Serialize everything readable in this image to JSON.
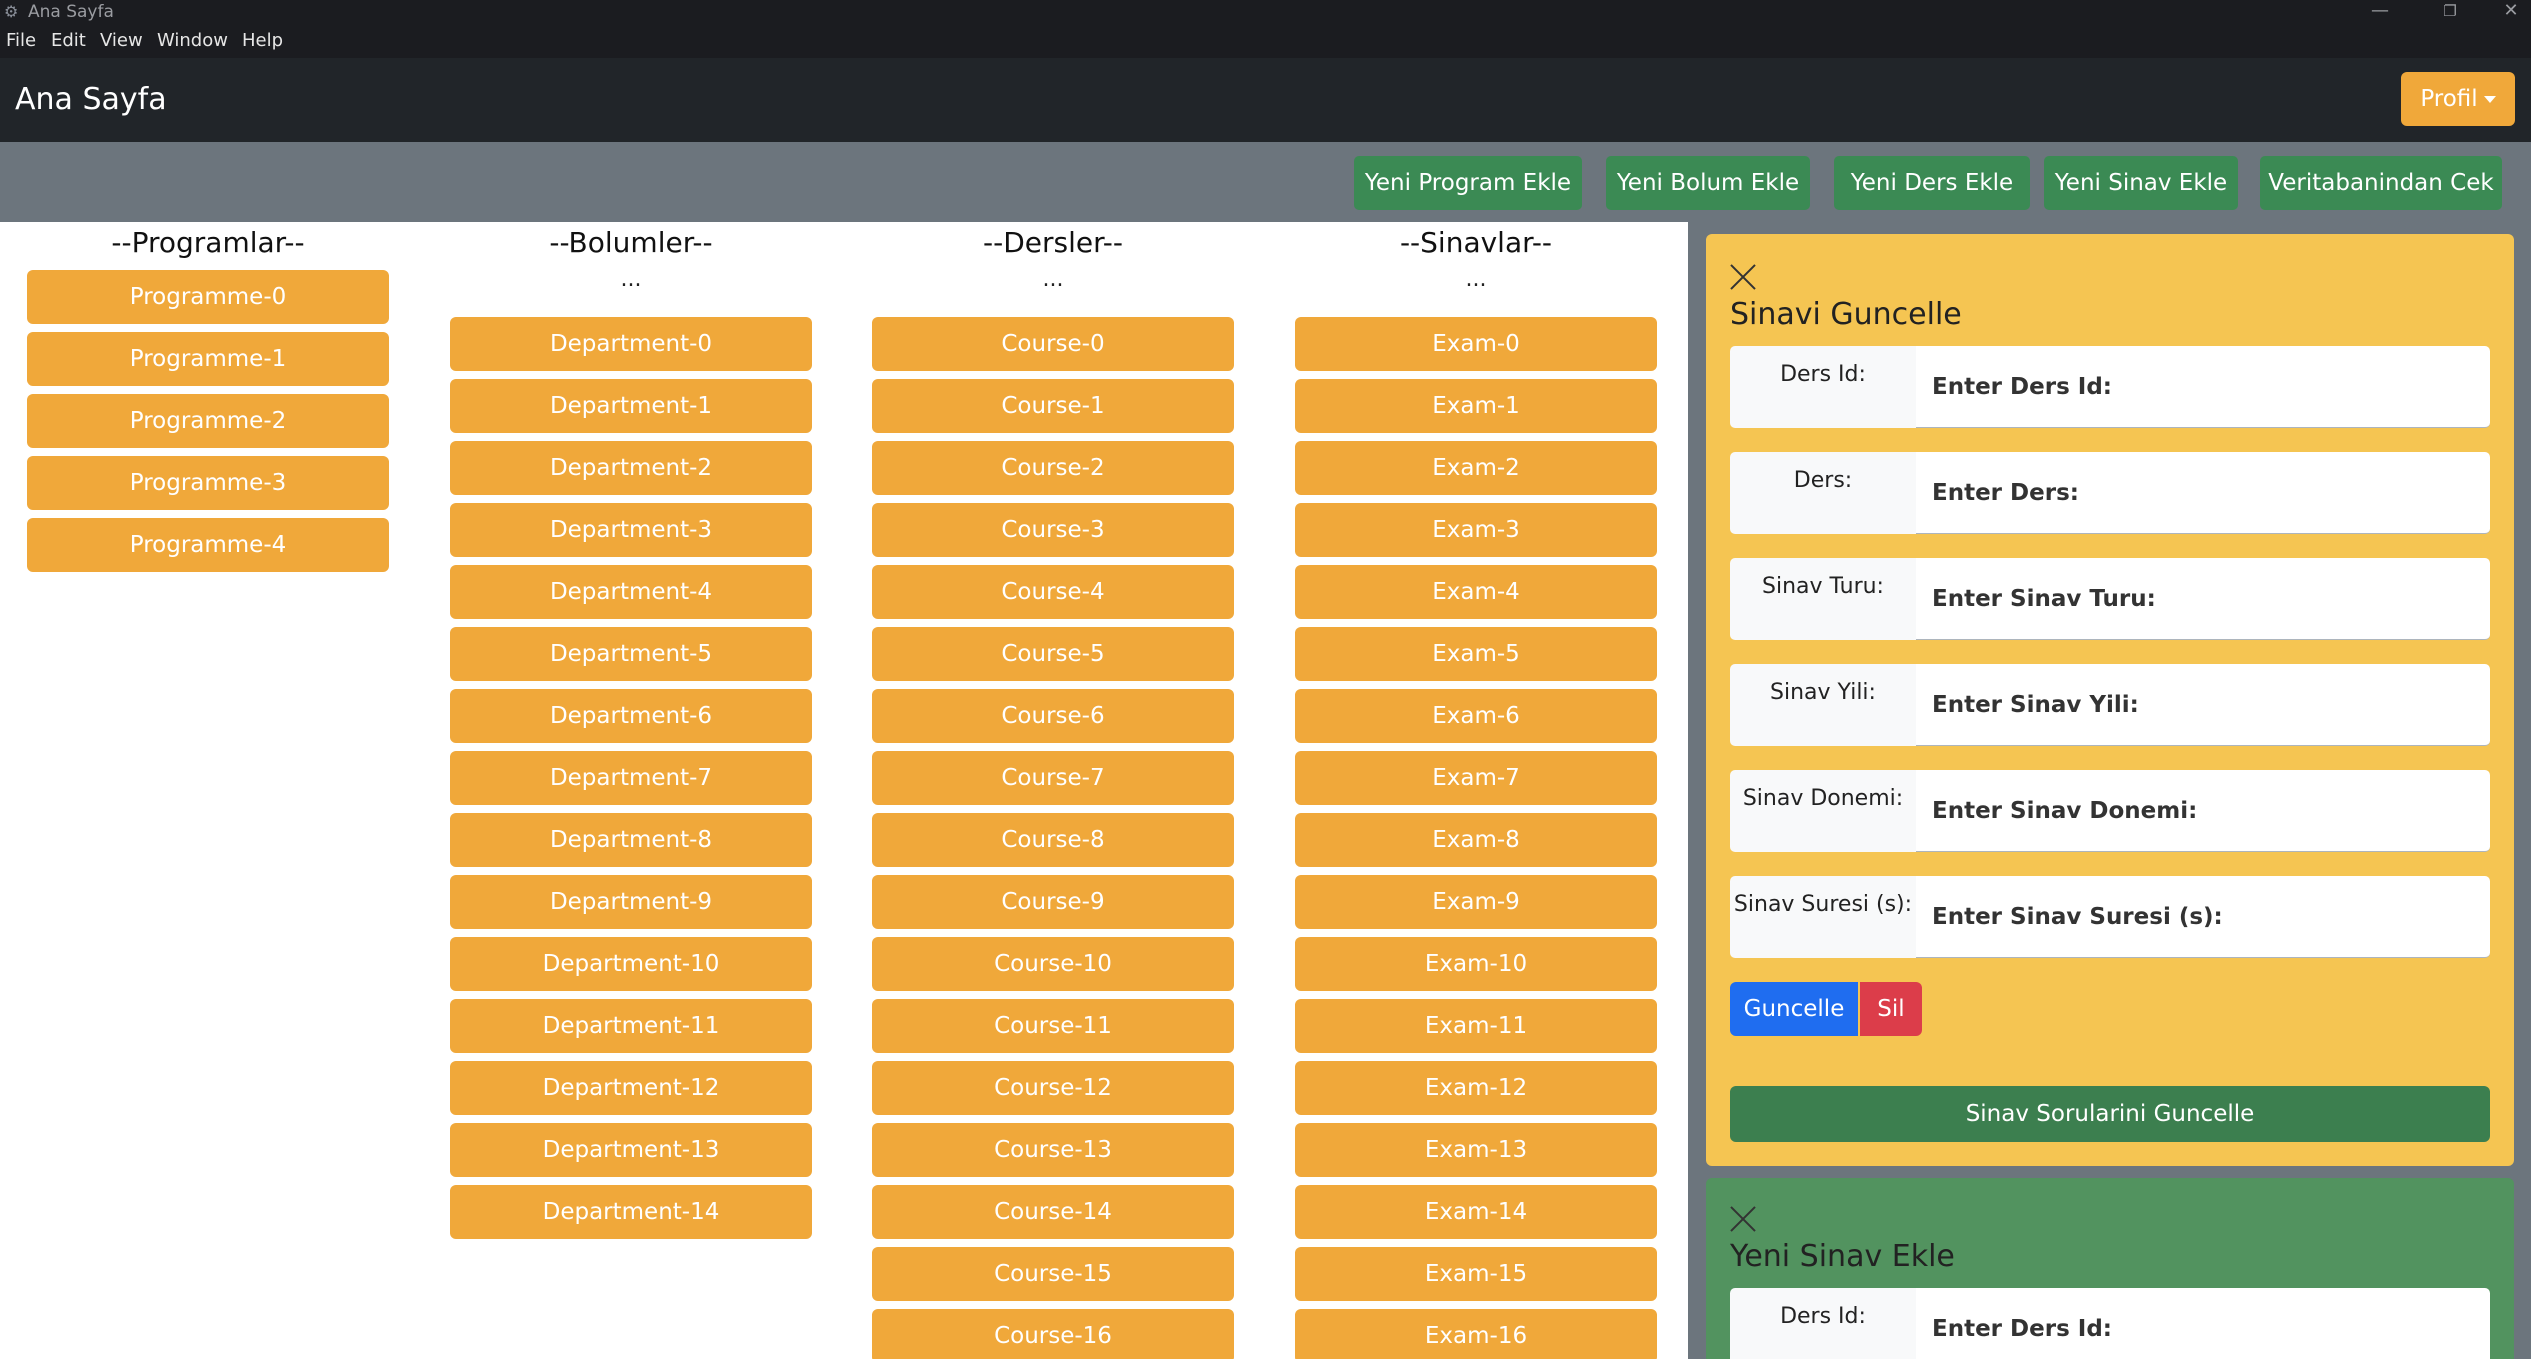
{
  "window": {
    "title": "Ana Sayfa",
    "minimize": "—",
    "restore": "❐",
    "close": "✕"
  },
  "menu": [
    "File",
    "Edit",
    "View",
    "Window",
    "Help"
  ],
  "navbar": {
    "brand": "Ana Sayfa",
    "profil_label": "Profil"
  },
  "actions": [
    "Yeni Program Ekle",
    "Yeni Bolum Ekle",
    "Yeni Ders Ekle",
    "Yeni Sinav Ekle",
    "Veritabanindan Cek"
  ],
  "columns": {
    "programlar": {
      "title": "--Programlar--",
      "dots": "",
      "items": [
        "Programme-0",
        "Programme-1",
        "Programme-2",
        "Programme-3",
        "Programme-4"
      ]
    },
    "bolumler": {
      "title": "--Bolumler--",
      "dots": "...",
      "items": [
        "Department-0",
        "Department-1",
        "Department-2",
        "Department-3",
        "Department-4",
        "Department-5",
        "Department-6",
        "Department-7",
        "Department-8",
        "Department-9",
        "Department-10",
        "Department-11",
        "Department-12",
        "Department-13",
        "Department-14"
      ]
    },
    "dersler": {
      "title": "--Dersler--",
      "dots": "...",
      "items": [
        "Course-0",
        "Course-1",
        "Course-2",
        "Course-3",
        "Course-4",
        "Course-5",
        "Course-6",
        "Course-7",
        "Course-8",
        "Course-9",
        "Course-10",
        "Course-11",
        "Course-12",
        "Course-13",
        "Course-14",
        "Course-15",
        "Course-16"
      ]
    },
    "sinavlar": {
      "title": "--Sinavlar--",
      "dots": "...",
      "items": [
        "Exam-0",
        "Exam-1",
        "Exam-2",
        "Exam-3",
        "Exam-4",
        "Exam-5",
        "Exam-6",
        "Exam-7",
        "Exam-8",
        "Exam-9",
        "Exam-10",
        "Exam-11",
        "Exam-12",
        "Exam-13",
        "Exam-14",
        "Exam-15",
        "Exam-16"
      ]
    }
  },
  "update_form": {
    "title": "Sinavi Guncelle",
    "fields": [
      {
        "label": "Ders Id:",
        "placeholder": "Enter Ders Id:"
      },
      {
        "label": "Ders:",
        "placeholder": "Enter Ders:"
      },
      {
        "label": "Sinav Turu:",
        "placeholder": "Enter Sinav Turu:"
      },
      {
        "label": "Sinav Yili:",
        "placeholder": "Enter Sinav Yili:"
      },
      {
        "label": "Sinav Donemi:",
        "placeholder": "Enter Sinav Donemi:"
      },
      {
        "label": "Sinav Suresi (s):",
        "placeholder": "Enter Sinav Suresi (s):"
      }
    ],
    "update_label": "Guncelle",
    "delete_label": "Sil",
    "questions_label": "Sinav Sorularini Guncelle"
  },
  "add_form": {
    "title": "Yeni Sinav Ekle",
    "fields": [
      {
        "label": "Ders Id:",
        "placeholder": "Enter Ders Id:"
      }
    ]
  },
  "colors": {
    "orange": "#f0a83a",
    "green": "#3b8a54",
    "gray": "#6c757d",
    "dark": "#212529",
    "update_card": "#f5c552",
    "add_card": "#52935f",
    "blue": "#1f6df0",
    "red": "#dc3d4a"
  }
}
